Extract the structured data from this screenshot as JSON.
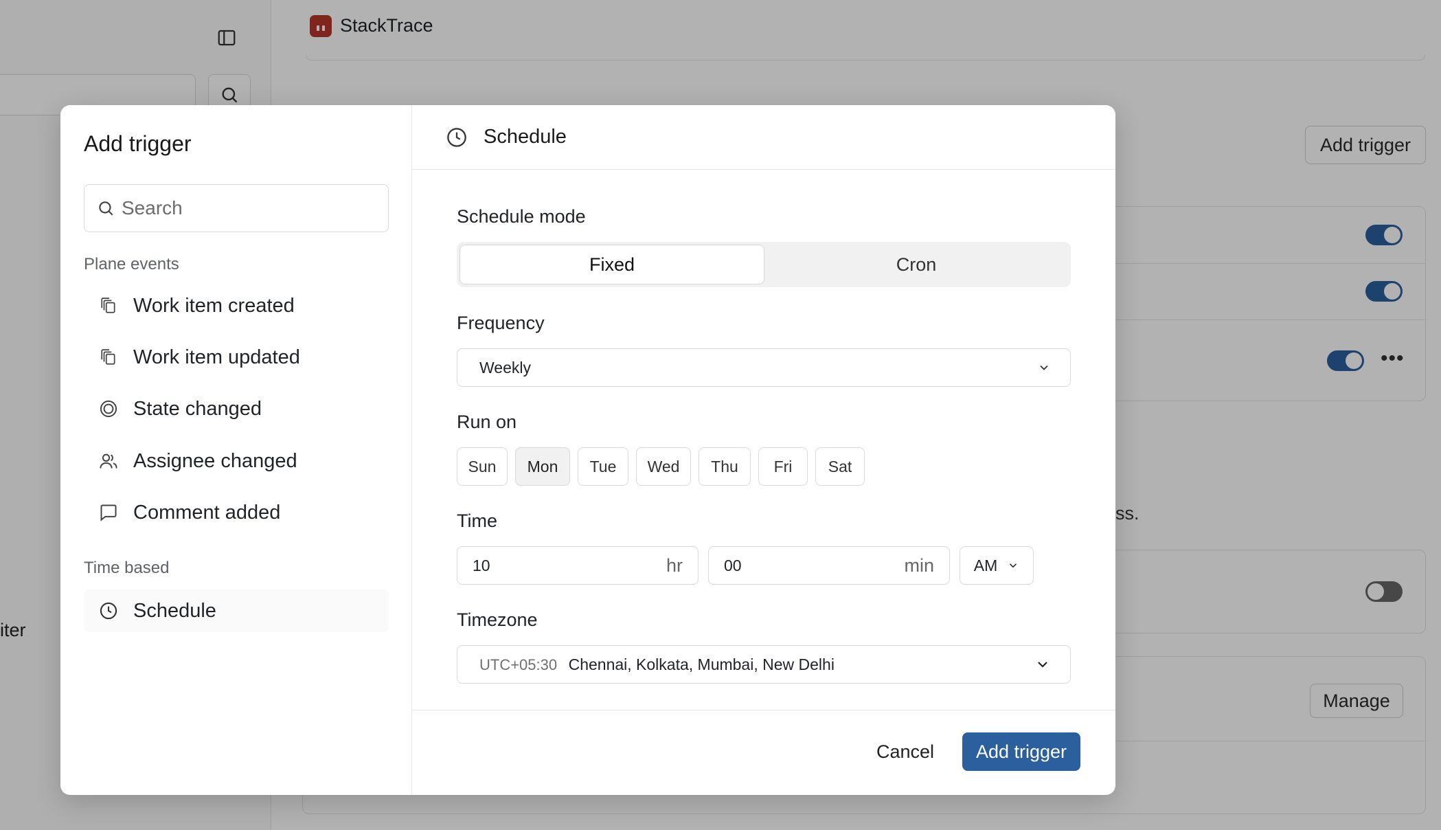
{
  "background": {
    "app_name": "StackTrace",
    "add_trigger_label": "Add trigger",
    "manage_label": "Manage",
    "partial_text_left": "iter",
    "partial_text_right": "ss.",
    "toggles": [
      {
        "state": "on"
      },
      {
        "state": "on"
      },
      {
        "state": "on"
      },
      {
        "state": "off"
      }
    ]
  },
  "modal": {
    "title": "Add trigger",
    "search": {
      "placeholder": "Search",
      "value": ""
    },
    "sections": {
      "plane_events": "Plane events",
      "time_based": "Time based"
    },
    "plane_events": [
      {
        "label": "Work item created",
        "icon": "work-item-icon"
      },
      {
        "label": "Work item updated",
        "icon": "work-item-icon"
      },
      {
        "label": "State changed",
        "icon": "state-icon"
      },
      {
        "label": "Assignee changed",
        "icon": "users-icon"
      },
      {
        "label": "Comment added",
        "icon": "comment-icon"
      }
    ],
    "time_based": [
      {
        "label": "Schedule",
        "icon": "clock-icon",
        "selected": true
      }
    ],
    "panel": {
      "title": "Schedule",
      "schedule_mode_label": "Schedule mode",
      "modes": [
        "Fixed",
        "Cron"
      ],
      "selected_mode": "Fixed",
      "frequency_label": "Frequency",
      "frequency_value": "Weekly",
      "run_on_label": "Run on",
      "days": [
        "Sun",
        "Mon",
        "Tue",
        "Wed",
        "Thu",
        "Fri",
        "Sat"
      ],
      "selected_day": "Mon",
      "time_label": "Time",
      "hour_value": "10",
      "hour_unit": "hr",
      "minute_value": "00",
      "minute_unit": "min",
      "ampm_value": "AM",
      "timezone_label": "Timezone",
      "timezone_offset": "UTC+05:30",
      "timezone_name": "Chennai, Kolkata, Mumbai, New Delhi"
    },
    "footer": {
      "cancel_label": "Cancel",
      "submit_label": "Add trigger"
    }
  },
  "colors": {
    "primary": "#2b5f9e",
    "brand_logo": "#b8352a",
    "overlay": "rgba(0,0,0,0.30)"
  }
}
